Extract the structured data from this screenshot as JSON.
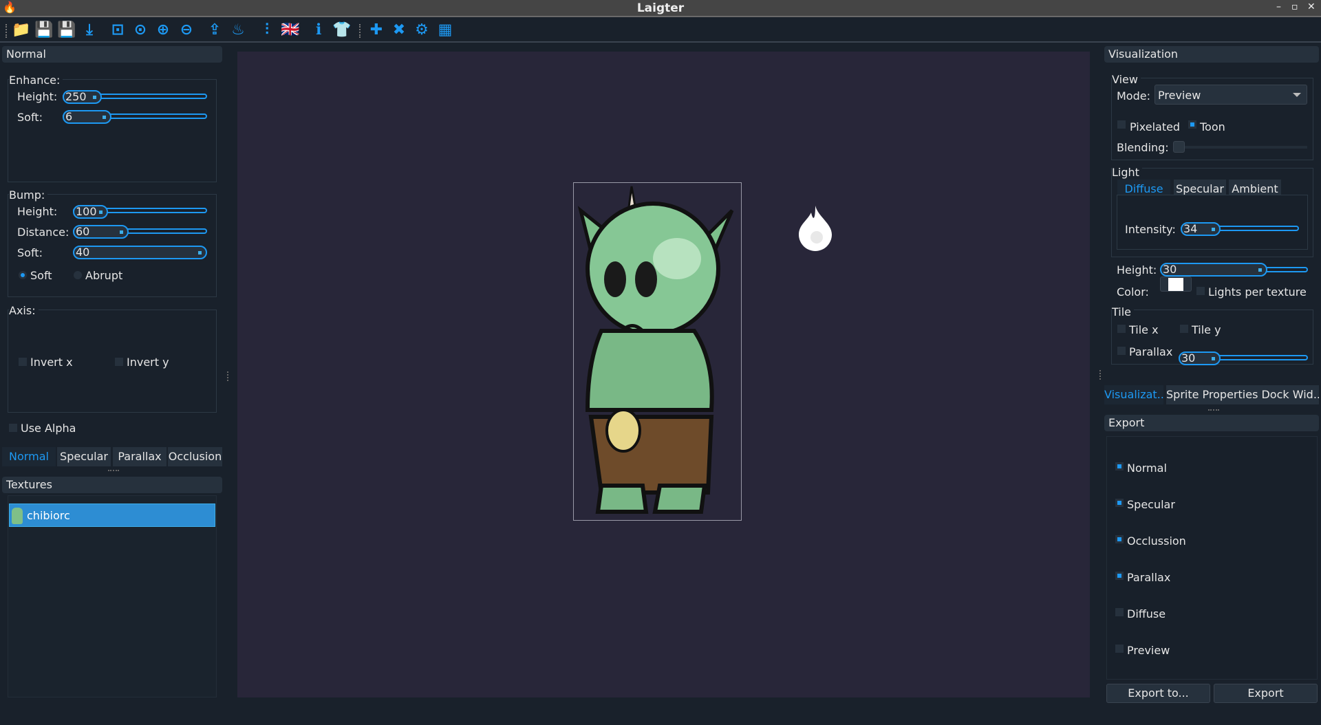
{
  "window": {
    "title": "Laigter",
    "min": "–",
    "max": "▫",
    "close": "✕"
  },
  "toolbar": [
    {
      "name": "open-icon",
      "glyph": "📁"
    },
    {
      "name": "save-icon",
      "glyph": "💾"
    },
    {
      "name": "save-as-icon",
      "glyph": "💾"
    },
    {
      "name": "import-icon",
      "glyph": "⤓"
    },
    {
      "name": "zoom-fit-icon",
      "glyph": "⊡"
    },
    {
      "name": "zoom-100-icon",
      "glyph": "⊙"
    },
    {
      "name": "zoom-in-icon",
      "glyph": "⊕"
    },
    {
      "name": "zoom-out-icon",
      "glyph": "⊖"
    },
    {
      "name": "export-icon",
      "glyph": "⇪"
    },
    {
      "name": "add-light-icon",
      "glyph": "♨"
    },
    {
      "name": "settings-sliders-icon",
      "glyph": "⫶"
    },
    {
      "name": "language-flag-icon",
      "glyph": "🇬🇧"
    },
    {
      "name": "info-icon",
      "glyph": "ℹ"
    },
    {
      "name": "shirt-icon",
      "glyph": "👕"
    },
    {
      "name": "plugin-add-icon",
      "glyph": "✚"
    },
    {
      "name": "plugin-remove-icon",
      "glyph": "✖"
    },
    {
      "name": "plugin-settings-icon",
      "glyph": "⚙"
    },
    {
      "name": "tileset-icon",
      "glyph": "▦"
    }
  ],
  "left": {
    "header": "Normal",
    "enhance": {
      "title": "Enhance:",
      "height_label": "Height:",
      "height": "250",
      "soft_label": "Soft:",
      "soft": "6"
    },
    "bump": {
      "title": "Bump:",
      "height_label": "Height:",
      "height": "100",
      "distance_label": "Distance:",
      "distance": "60",
      "soft_label": "Soft:",
      "soft": "40",
      "radio_soft": "Soft",
      "radio_abrupt": "Abrupt"
    },
    "axis": {
      "title": "Axis:",
      "invert_x": "Invert x",
      "invert_y": "Invert y"
    },
    "use_alpha": "Use Alpha",
    "tabs": [
      "Normal",
      "Specular",
      "Parallax",
      "Occlusion"
    ],
    "textures_header": "Textures",
    "textures": [
      "chibiorc"
    ]
  },
  "right": {
    "header": "Visualization",
    "view": {
      "title": "View",
      "mode_label": "Mode:",
      "mode": "Preview",
      "pixelated": "Pixelated",
      "toon": "Toon",
      "blending": "Blending:"
    },
    "light": {
      "title": "Light",
      "tabs": [
        "Diffuse",
        "Specular",
        "Ambient"
      ],
      "intensity_label": "Intensity:",
      "intensity": "34",
      "height_label": "Height:",
      "height": "30",
      "color_label": "Color:",
      "color": "#ffffff",
      "lights_per_texture": "Lights per texture"
    },
    "tile": {
      "title": "Tile",
      "tile_x": "Tile x",
      "tile_y": "Tile y",
      "parallax": "Parallax",
      "parallax_value": "30"
    },
    "dock_tabs": [
      "Visualizat..",
      "Sprite Properties Dock Wid.."
    ],
    "export_header": "Export",
    "export_items": [
      {
        "label": "Normal",
        "checked": true
      },
      {
        "label": "Specular",
        "checked": true
      },
      {
        "label": "Occlussion",
        "checked": true
      },
      {
        "label": "Parallax",
        "checked": true
      },
      {
        "label": "Diffuse",
        "checked": false
      },
      {
        "label": "Preview",
        "checked": false
      }
    ],
    "export_to": "Export to...",
    "export": "Export"
  }
}
